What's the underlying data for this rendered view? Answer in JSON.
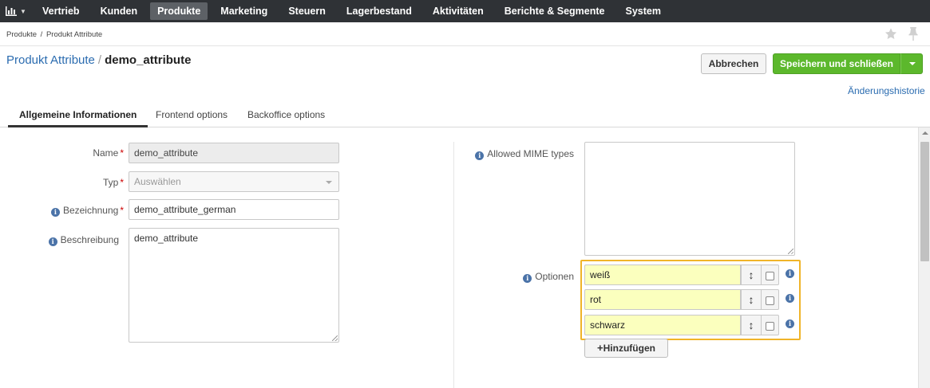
{
  "topnav": {
    "items": [
      {
        "label": "Vertrieb",
        "active": false
      },
      {
        "label": "Kunden",
        "active": false
      },
      {
        "label": "Produkte",
        "active": true
      },
      {
        "label": "Marketing",
        "active": false
      },
      {
        "label": "Steuern",
        "active": false
      },
      {
        "label": "Lagerbestand",
        "active": false
      },
      {
        "label": "Aktivitäten",
        "active": false
      },
      {
        "label": "Berichte & Segmente",
        "active": false
      },
      {
        "label": "System",
        "active": false
      }
    ],
    "logo_icon": "bar-chart-icon"
  },
  "breadcrumb": {
    "items": [
      "Produkte",
      "/",
      "Produkt Attribute"
    ]
  },
  "header": {
    "parent": "Produkt Attribute",
    "separator": "/",
    "current": "demo_attribute",
    "cancel_label": "Abbrechen",
    "save_label": "Speichern und schließen",
    "history_label": "Änderungshistorie"
  },
  "tabs": [
    {
      "label": "Allgemeine Informationen",
      "active": true
    },
    {
      "label": "Frontend options",
      "active": false
    },
    {
      "label": "Backoffice options",
      "active": false
    }
  ],
  "form": {
    "name": {
      "label": "Name",
      "required_mark": "*",
      "value": "demo_attribute"
    },
    "type": {
      "label": "Typ",
      "required_mark": "*",
      "value": "Auswählen"
    },
    "label": {
      "label": "Bezeichnung",
      "required_mark": "*",
      "value": "demo_attribute_german"
    },
    "description": {
      "label": "Beschreibung",
      "value": "demo_attribute"
    },
    "mime": {
      "label": "Allowed MIME types",
      "value": ""
    },
    "options": {
      "label": "Optionen",
      "items": [
        {
          "value": "weiß"
        },
        {
          "value": "rot"
        },
        {
          "value": "schwarz"
        }
      ],
      "add_label": "Hinzufügen",
      "move_glyph": "↕",
      "info_glyph": "i"
    }
  },
  "colors": {
    "nav_bg": "#2f3236",
    "accent_green": "#5cb82c",
    "link_blue": "#2b6cb0",
    "highlight_border": "#f0b429",
    "option_bg": "#fbffbe"
  }
}
